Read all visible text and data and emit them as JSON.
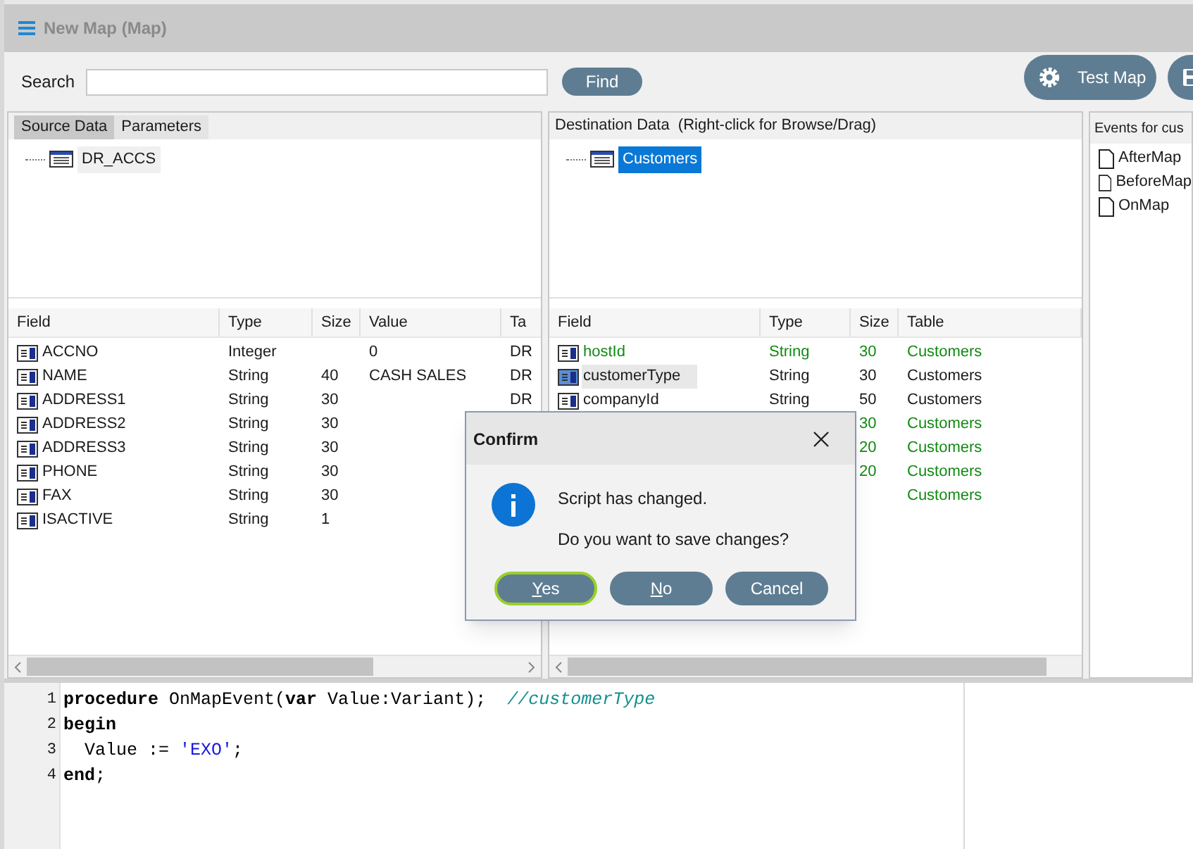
{
  "window": {
    "title": "New Map (Map)"
  },
  "search": {
    "label": "Search",
    "button": "Find"
  },
  "toolbar": {
    "buttons": [
      {
        "label": "Test Map",
        "kind": "gear"
      },
      {
        "kind": "save"
      }
    ]
  },
  "source": {
    "tabs": [
      {
        "label": "Source Data",
        "selected": true
      },
      {
        "label": "Parameters",
        "selected": false
      }
    ],
    "tree": [
      {
        "label": "DR_ACCS",
        "selected": false
      }
    ],
    "table": {
      "columns": [
        "Field",
        "Type",
        "Size",
        "Value",
        "Ta"
      ],
      "rows": [
        {
          "cells": [
            "ACCNO",
            "Integer",
            "",
            "0",
            "DR"
          ]
        },
        {
          "cells": [
            "NAME",
            "String",
            "40",
            "CASH SALES",
            "DR"
          ]
        },
        {
          "cells": [
            "ADDRESS1",
            "String",
            "30",
            "",
            "DR"
          ]
        },
        {
          "cells": [
            "ADDRESS2",
            "String",
            "30",
            "",
            ""
          ]
        },
        {
          "cells": [
            "ADDRESS3",
            "String",
            "30",
            "",
            ""
          ]
        },
        {
          "cells": [
            "PHONE",
            "String",
            "30",
            "",
            ""
          ]
        },
        {
          "cells": [
            "FAX",
            "String",
            "30",
            "",
            ""
          ]
        },
        {
          "cells": [
            "ISACTIVE",
            "String",
            "1",
            "",
            ""
          ]
        }
      ]
    }
  },
  "destination": {
    "title": "Destination Data  (Right-click for Browse/Drag)",
    "tree": [
      {
        "label": "Customers",
        "selected": true
      }
    ],
    "table": {
      "columns": [
        "Field",
        "Type",
        "Size",
        "Table"
      ],
      "rows": [
        {
          "cells": [
            "hostId",
            "String",
            "30",
            "Customers"
          ],
          "mapped": true,
          "selected": false
        },
        {
          "cells": [
            "customerType",
            "String",
            "30",
            "Customers"
          ],
          "mapped": false,
          "selected": true
        },
        {
          "cells": [
            "companyId",
            "String",
            "50",
            "Customers"
          ],
          "mapped": false,
          "selected": false
        },
        {
          "cells": [
            "",
            "",
            "30",
            "Customers"
          ],
          "mapped": true,
          "selected": false
        },
        {
          "cells": [
            "",
            "",
            "20",
            "Customers"
          ],
          "mapped": true,
          "selected": false
        },
        {
          "cells": [
            "",
            "",
            "20",
            "Customers"
          ],
          "mapped": true,
          "selected": false
        },
        {
          "cells": [
            "",
            "",
            "",
            "Customers"
          ],
          "mapped": true,
          "selected": false
        }
      ]
    }
  },
  "events": {
    "title": "Events for cus",
    "items": [
      "AfterMap",
      "BeforeMap",
      "OnMap"
    ]
  },
  "code": {
    "lines": [
      {
        "number": "1",
        "tokens": [
          {
            "kind": "keyword",
            "text": "procedure"
          },
          {
            "kind": "plain",
            "text": " OnMapEvent("
          },
          {
            "kind": "keyword",
            "text": "var"
          },
          {
            "kind": "plain",
            "text": " Value:Variant);  "
          },
          {
            "kind": "comment",
            "text": "//customerType"
          }
        ]
      },
      {
        "number": "2",
        "tokens": [
          {
            "kind": "keyword",
            "text": "begin"
          }
        ]
      },
      {
        "number": "3",
        "tokens": [
          {
            "kind": "plain",
            "text": "  Value := "
          },
          {
            "kind": "string",
            "text": "'EXO'"
          },
          {
            "kind": "plain",
            "text": ";"
          }
        ]
      },
      {
        "number": "4",
        "tokens": [
          {
            "kind": "keyword",
            "text": "end"
          },
          {
            "kind": "plain",
            "text": ";"
          }
        ]
      }
    ]
  },
  "dialog": {
    "title": "Confirm",
    "messages": [
      "Script has changed.",
      "Do you want to save changes?"
    ],
    "buttons": [
      {
        "label": "Yes",
        "mnemonic": true,
        "default": true
      },
      {
        "label": "No",
        "mnemonic": true,
        "default": false
      },
      {
        "label": "Cancel",
        "mnemonic": false,
        "default": false
      }
    ]
  }
}
